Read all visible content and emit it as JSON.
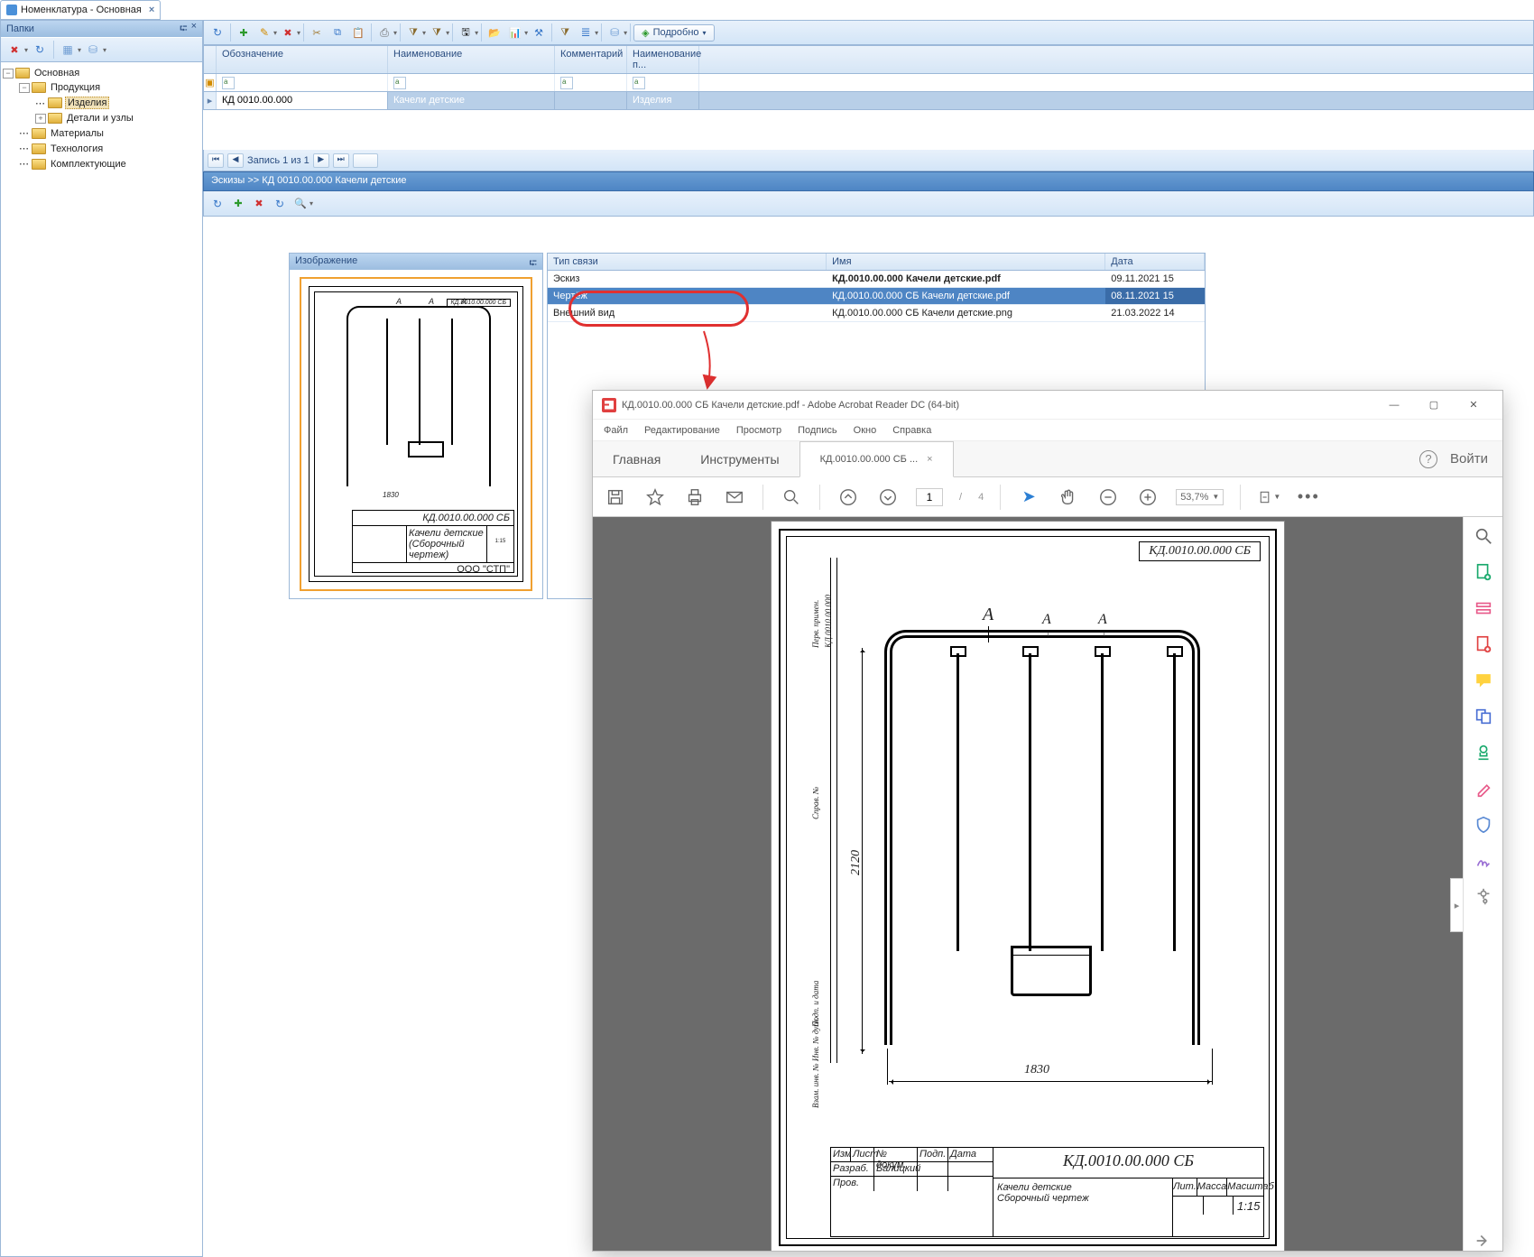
{
  "app_tab": {
    "title": "Номенклатура - Основная"
  },
  "folders": {
    "header": "Папки",
    "tree": [
      {
        "label": "Основная",
        "level": 0,
        "expanded": true
      },
      {
        "label": "Продукция",
        "level": 1,
        "expanded": true
      },
      {
        "label": "Изделия",
        "level": 2,
        "selected": true,
        "leaf": true
      },
      {
        "label": "Детали и узлы",
        "level": 2,
        "expanded": false
      },
      {
        "label": "Материалы",
        "level": 1,
        "leaf": true
      },
      {
        "label": "Технология",
        "level": 1,
        "leaf": true
      },
      {
        "label": "Комплектующие",
        "level": 1,
        "leaf": true
      }
    ]
  },
  "main_toolbar": {
    "details": "Подробно"
  },
  "grid": {
    "columns": [
      "Обозначение",
      "Наименование",
      "Комментарий",
      "Наименование п..."
    ],
    "row": {
      "c0": "КД 0010.00.000",
      "c1": "Качели детские",
      "c2": "",
      "c3": "Изделия"
    }
  },
  "pager": {
    "text": "Запись 1 из 1"
  },
  "esk_bar": "Эскизы >> КД 0010.00.000 Качели детские",
  "image_panel": {
    "header": "Изображение"
  },
  "thumb": {
    "num": "КД.0010.00.000 СБ",
    "name": "Качели детские",
    "sub": "(Сборочный чертеж)",
    "org": "ООО \"СТП\""
  },
  "files": {
    "columns": [
      "Тип связи",
      "Имя",
      "Дата"
    ],
    "rows": [
      {
        "type": "Эскиз",
        "name": "КД.0010.00.000 Качели детские.pdf",
        "date": "09.11.2021 15",
        "bold": true
      },
      {
        "type": "Чертёж",
        "name": "КД.0010.00.000 СБ Качели детские.pdf",
        "date": "08.11.2021 15",
        "sel": true
      },
      {
        "type": "Внешний вид",
        "name": "КД.0010.00.000 СБ Качели детские.png",
        "date": "21.03.2022 14"
      }
    ]
  },
  "pdf": {
    "title": "КД.0010.00.000 СБ Качели детские.pdf - Adobe Acrobat Reader DC (64-bit)",
    "menu": [
      "Файл",
      "Редактирование",
      "Просмотр",
      "Подпись",
      "Окно",
      "Справка"
    ],
    "tabs": {
      "home": "Главная",
      "tools": "Инструменты",
      "doc": "КД.0010.00.000 СБ ..."
    },
    "login": "Войти",
    "page_current": "1",
    "page_total": "4",
    "zoom": "53,7%",
    "drawing": {
      "number": "КД.0010.00.000 СБ",
      "dim_w": "1830",
      "dim_h": "2120",
      "markA": "А",
      "tb": {
        "num": "КД.0010.00.000 СБ",
        "name1": "Качели детские",
        "name2": "Сборочный чертеж",
        "lit": "Лит.",
        "massa": "Масса",
        "scale_h": "Масштаб",
        "scale": "1:15",
        "izm": "Изм",
        "list": "Лист",
        "ndokum": "№ докум.",
        "podp": "Подп.",
        "data": "Дата",
        "razrab": "Разраб.",
        "razrab_n": "Балицкий",
        "prov": "Пров."
      }
    }
  }
}
